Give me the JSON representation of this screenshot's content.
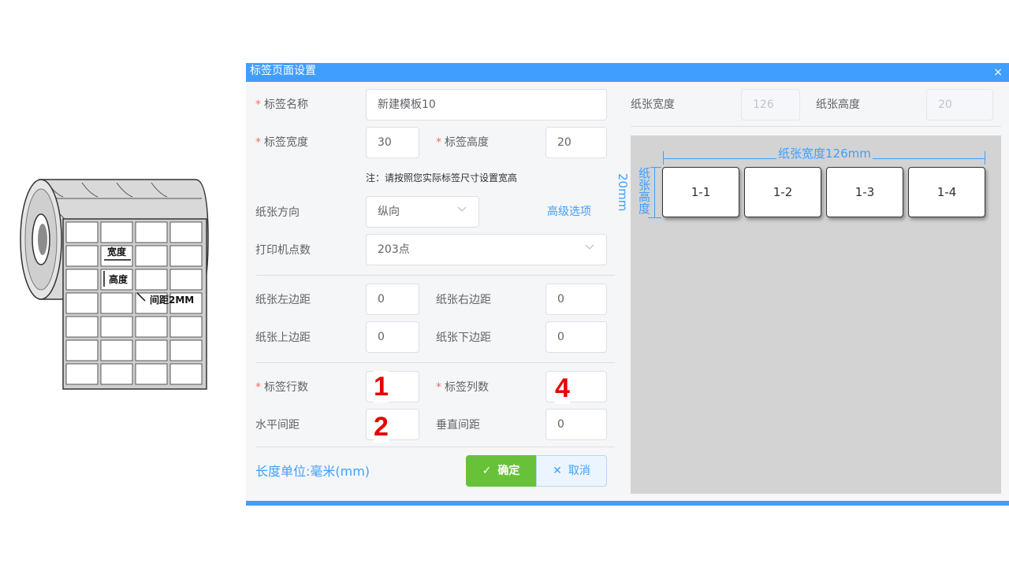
{
  "illustration": {
    "width_label": "宽度",
    "height_label": "高度",
    "gap_label": "间距2MM"
  },
  "dialog": {
    "title": "标签页面设置",
    "close_glyph": "×"
  },
  "form": {
    "label_name": {
      "label": "标签名称",
      "value": "新建模板10"
    },
    "label_width": {
      "label": "标签宽度",
      "value": "30"
    },
    "label_height": {
      "label": "标签高度",
      "value": "20"
    },
    "note": "注：请按照您实际标签尺寸设置宽高",
    "paper_direction": {
      "label": "纸张方向",
      "value": "纵向"
    },
    "advanced_link": "高级选项",
    "printer_dpi": {
      "label": "打印机点数",
      "value": "203点"
    },
    "margin_left": {
      "label": "纸张左边距",
      "value": "0"
    },
    "margin_right": {
      "label": "纸张右边距",
      "value": "0"
    },
    "margin_top": {
      "label": "纸张上边距",
      "value": "0"
    },
    "margin_bottom": {
      "label": "纸张下边距",
      "value": "0"
    },
    "rows": {
      "label": "标签行数",
      "value": "1"
    },
    "cols": {
      "label": "标签列数",
      "value": "4"
    },
    "h_gap": {
      "label": "水平间距",
      "value": "2"
    },
    "v_gap": {
      "label": "垂直间距",
      "value": "0"
    },
    "unit_text": "长度单位:毫米(mm)"
  },
  "buttons": {
    "ok_icon": "✓",
    "ok": "确定",
    "cancel_icon": "✕",
    "cancel": "取消"
  },
  "paper": {
    "width_label": "纸张宽度",
    "width_value": "126",
    "height_label": "纸张高度",
    "height_value": "20"
  },
  "preview": {
    "width_dim": "纸张宽度126mm",
    "height_dim": "纸张高度",
    "height_value": "20mm",
    "cells": [
      "1-1",
      "1-2",
      "1-3",
      "1-4"
    ]
  },
  "colors": {
    "primary": "#409eff",
    "success": "#67c23a",
    "annotation_red": "#e60000",
    "required": "#f56c6c"
  }
}
